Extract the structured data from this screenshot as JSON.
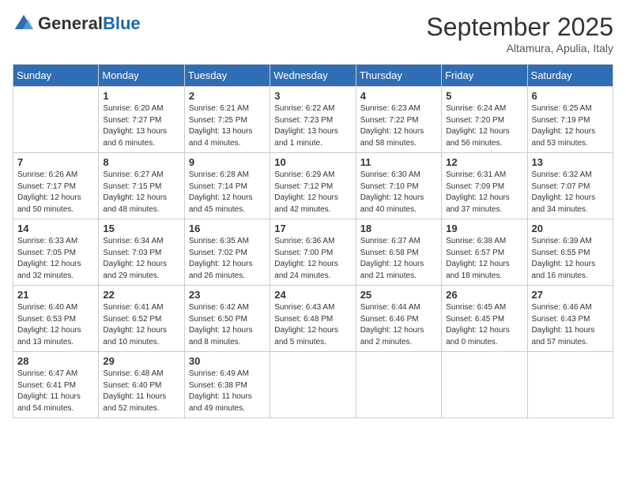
{
  "header": {
    "logo_general": "General",
    "logo_blue": "Blue",
    "month": "September 2025",
    "location": "Altamura, Apulia, Italy"
  },
  "days_of_week": [
    "Sunday",
    "Monday",
    "Tuesday",
    "Wednesday",
    "Thursday",
    "Friday",
    "Saturday"
  ],
  "weeks": [
    [
      {
        "day": "",
        "info": ""
      },
      {
        "day": "1",
        "info": "Sunrise: 6:20 AM\nSunset: 7:27 PM\nDaylight: 13 hours\nand 6 minutes."
      },
      {
        "day": "2",
        "info": "Sunrise: 6:21 AM\nSunset: 7:25 PM\nDaylight: 13 hours\nand 4 minutes."
      },
      {
        "day": "3",
        "info": "Sunrise: 6:22 AM\nSunset: 7:23 PM\nDaylight: 13 hours\nand 1 minute."
      },
      {
        "day": "4",
        "info": "Sunrise: 6:23 AM\nSunset: 7:22 PM\nDaylight: 12 hours\nand 58 minutes."
      },
      {
        "day": "5",
        "info": "Sunrise: 6:24 AM\nSunset: 7:20 PM\nDaylight: 12 hours\nand 56 minutes."
      },
      {
        "day": "6",
        "info": "Sunrise: 6:25 AM\nSunset: 7:19 PM\nDaylight: 12 hours\nand 53 minutes."
      }
    ],
    [
      {
        "day": "7",
        "info": "Sunrise: 6:26 AM\nSunset: 7:17 PM\nDaylight: 12 hours\nand 50 minutes."
      },
      {
        "day": "8",
        "info": "Sunrise: 6:27 AM\nSunset: 7:15 PM\nDaylight: 12 hours\nand 48 minutes."
      },
      {
        "day": "9",
        "info": "Sunrise: 6:28 AM\nSunset: 7:14 PM\nDaylight: 12 hours\nand 45 minutes."
      },
      {
        "day": "10",
        "info": "Sunrise: 6:29 AM\nSunset: 7:12 PM\nDaylight: 12 hours\nand 42 minutes."
      },
      {
        "day": "11",
        "info": "Sunrise: 6:30 AM\nSunset: 7:10 PM\nDaylight: 12 hours\nand 40 minutes."
      },
      {
        "day": "12",
        "info": "Sunrise: 6:31 AM\nSunset: 7:09 PM\nDaylight: 12 hours\nand 37 minutes."
      },
      {
        "day": "13",
        "info": "Sunrise: 6:32 AM\nSunset: 7:07 PM\nDaylight: 12 hours\nand 34 minutes."
      }
    ],
    [
      {
        "day": "14",
        "info": "Sunrise: 6:33 AM\nSunset: 7:05 PM\nDaylight: 12 hours\nand 32 minutes."
      },
      {
        "day": "15",
        "info": "Sunrise: 6:34 AM\nSunset: 7:03 PM\nDaylight: 12 hours\nand 29 minutes."
      },
      {
        "day": "16",
        "info": "Sunrise: 6:35 AM\nSunset: 7:02 PM\nDaylight: 12 hours\nand 26 minutes."
      },
      {
        "day": "17",
        "info": "Sunrise: 6:36 AM\nSunset: 7:00 PM\nDaylight: 12 hours\nand 24 minutes."
      },
      {
        "day": "18",
        "info": "Sunrise: 6:37 AM\nSunset: 6:58 PM\nDaylight: 12 hours\nand 21 minutes."
      },
      {
        "day": "19",
        "info": "Sunrise: 6:38 AM\nSunset: 6:57 PM\nDaylight: 12 hours\nand 18 minutes."
      },
      {
        "day": "20",
        "info": "Sunrise: 6:39 AM\nSunset: 6:55 PM\nDaylight: 12 hours\nand 16 minutes."
      }
    ],
    [
      {
        "day": "21",
        "info": "Sunrise: 6:40 AM\nSunset: 6:53 PM\nDaylight: 12 hours\nand 13 minutes."
      },
      {
        "day": "22",
        "info": "Sunrise: 6:41 AM\nSunset: 6:52 PM\nDaylight: 12 hours\nand 10 minutes."
      },
      {
        "day": "23",
        "info": "Sunrise: 6:42 AM\nSunset: 6:50 PM\nDaylight: 12 hours\nand 8 minutes."
      },
      {
        "day": "24",
        "info": "Sunrise: 6:43 AM\nSunset: 6:48 PM\nDaylight: 12 hours\nand 5 minutes."
      },
      {
        "day": "25",
        "info": "Sunrise: 6:44 AM\nSunset: 6:46 PM\nDaylight: 12 hours\nand 2 minutes."
      },
      {
        "day": "26",
        "info": "Sunrise: 6:45 AM\nSunset: 6:45 PM\nDaylight: 12 hours\nand 0 minutes."
      },
      {
        "day": "27",
        "info": "Sunrise: 6:46 AM\nSunset: 6:43 PM\nDaylight: 11 hours\nand 57 minutes."
      }
    ],
    [
      {
        "day": "28",
        "info": "Sunrise: 6:47 AM\nSunset: 6:41 PM\nDaylight: 11 hours\nand 54 minutes."
      },
      {
        "day": "29",
        "info": "Sunrise: 6:48 AM\nSunset: 6:40 PM\nDaylight: 11 hours\nand 52 minutes."
      },
      {
        "day": "30",
        "info": "Sunrise: 6:49 AM\nSunset: 6:38 PM\nDaylight: 11 hours\nand 49 minutes."
      },
      {
        "day": "",
        "info": ""
      },
      {
        "day": "",
        "info": ""
      },
      {
        "day": "",
        "info": ""
      },
      {
        "day": "",
        "info": ""
      }
    ]
  ]
}
